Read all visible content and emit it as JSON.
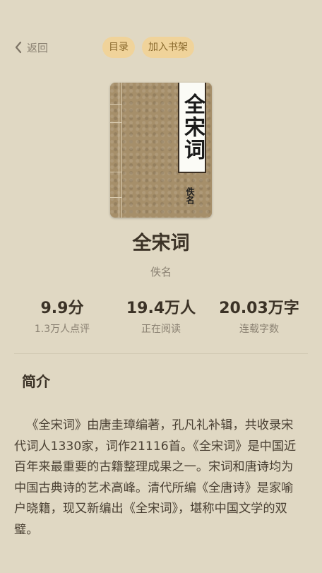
{
  "nav": {
    "back_label": "返回",
    "catalog_label": "目录",
    "add_shelf_label": "加入书架"
  },
  "book": {
    "cover_title": "全宋词",
    "cover_author": "佚名",
    "title": "全宋词",
    "author": "佚名"
  },
  "stats": [
    {
      "value": "9.9分",
      "label": "1.3万人点评"
    },
    {
      "value": "19.4万人",
      "label": "正在阅读"
    },
    {
      "value": "20.03万字",
      "label": "连载字数"
    }
  ],
  "intro": {
    "heading": "简介",
    "text": "《全宋词》由唐圭璋编著，孔凡礼补辑，共收录宋代词人1330家，词作21116首。《全宋词》是中国近百年来最重要的古籍整理成果之一。宋词和唐诗均为中国古典诗的艺术高峰。清代所编《全唐诗》是家喻户晓籍，现又新编出《全宋词》，堪称中国文学的双璧。"
  },
  "colors": {
    "background": "#e0d8c3",
    "pill_bg": "#f0d39a",
    "pill_text": "#8a6a2e",
    "primary_text": "#3b3226",
    "secondary_text": "#8a8172"
  }
}
